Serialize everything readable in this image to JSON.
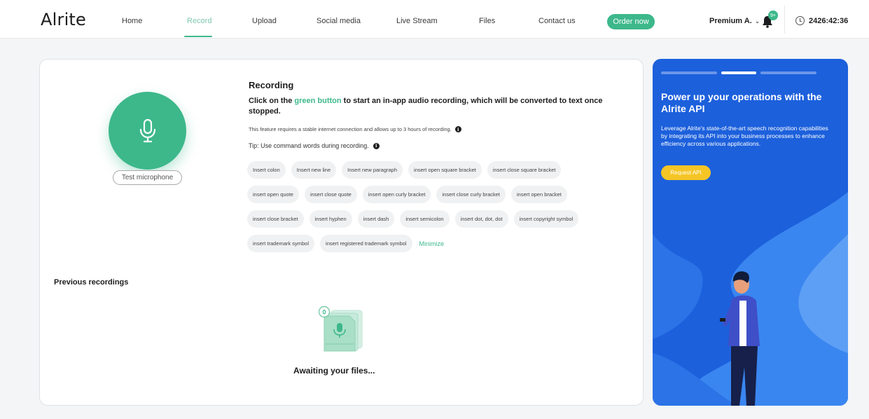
{
  "nav": {
    "logo_prefix": "Al",
    "logo_suffix": "rite",
    "items": [
      "Home",
      "Record",
      "Upload",
      "Social media",
      "Live Stream",
      "Files",
      "Contact us"
    ],
    "order_label": "Order now",
    "user_label": "Premium A.",
    "notification_badge": "9+",
    "timer": "2426:42:36"
  },
  "recording": {
    "title": "Recording",
    "desc_pre": "Click on the ",
    "desc_green": "green button",
    "desc_post": " to start an in-app audio recording, which will be converted to text once stopped.",
    "note": "This feature requires a stable internet connection and allows up to 3 hours of recording.",
    "tip": "Tip: Use command words during recording.",
    "test_mic_label": "Test microphone",
    "commands": [
      [
        "Insert colon",
        "Insert new line",
        "Insert new paragraph",
        "insert open square bracket",
        "insert close square bracket"
      ],
      [
        "insert open quote",
        "insert close quote",
        "insert open curly bracket",
        "insert close curly bracket",
        "insert open bracket"
      ],
      [
        "insert close bracket",
        "insert hyphen",
        "insert dash",
        "insert semicolon",
        "insert dot, dot, dot",
        "insert copyright symbol"
      ],
      [
        "insert trademark symbol",
        "insert registered trademark symbol"
      ]
    ],
    "minimize_label": "Minimize"
  },
  "previous": {
    "title": "Previous recordings",
    "count": "0",
    "empty_text": "Awaiting your files..."
  },
  "promo": {
    "title": "Power up your operations with the Alrite API",
    "text": "Leverage Alrite's state-of-the-art speech recognition capabilities by integrating its API into your business processes to enhance efficiency across various applications.",
    "button": "Request API"
  },
  "colors": {
    "accent": "#3db88b",
    "promo_bg": "#1c60dc",
    "promo_button": "#f5c525"
  }
}
